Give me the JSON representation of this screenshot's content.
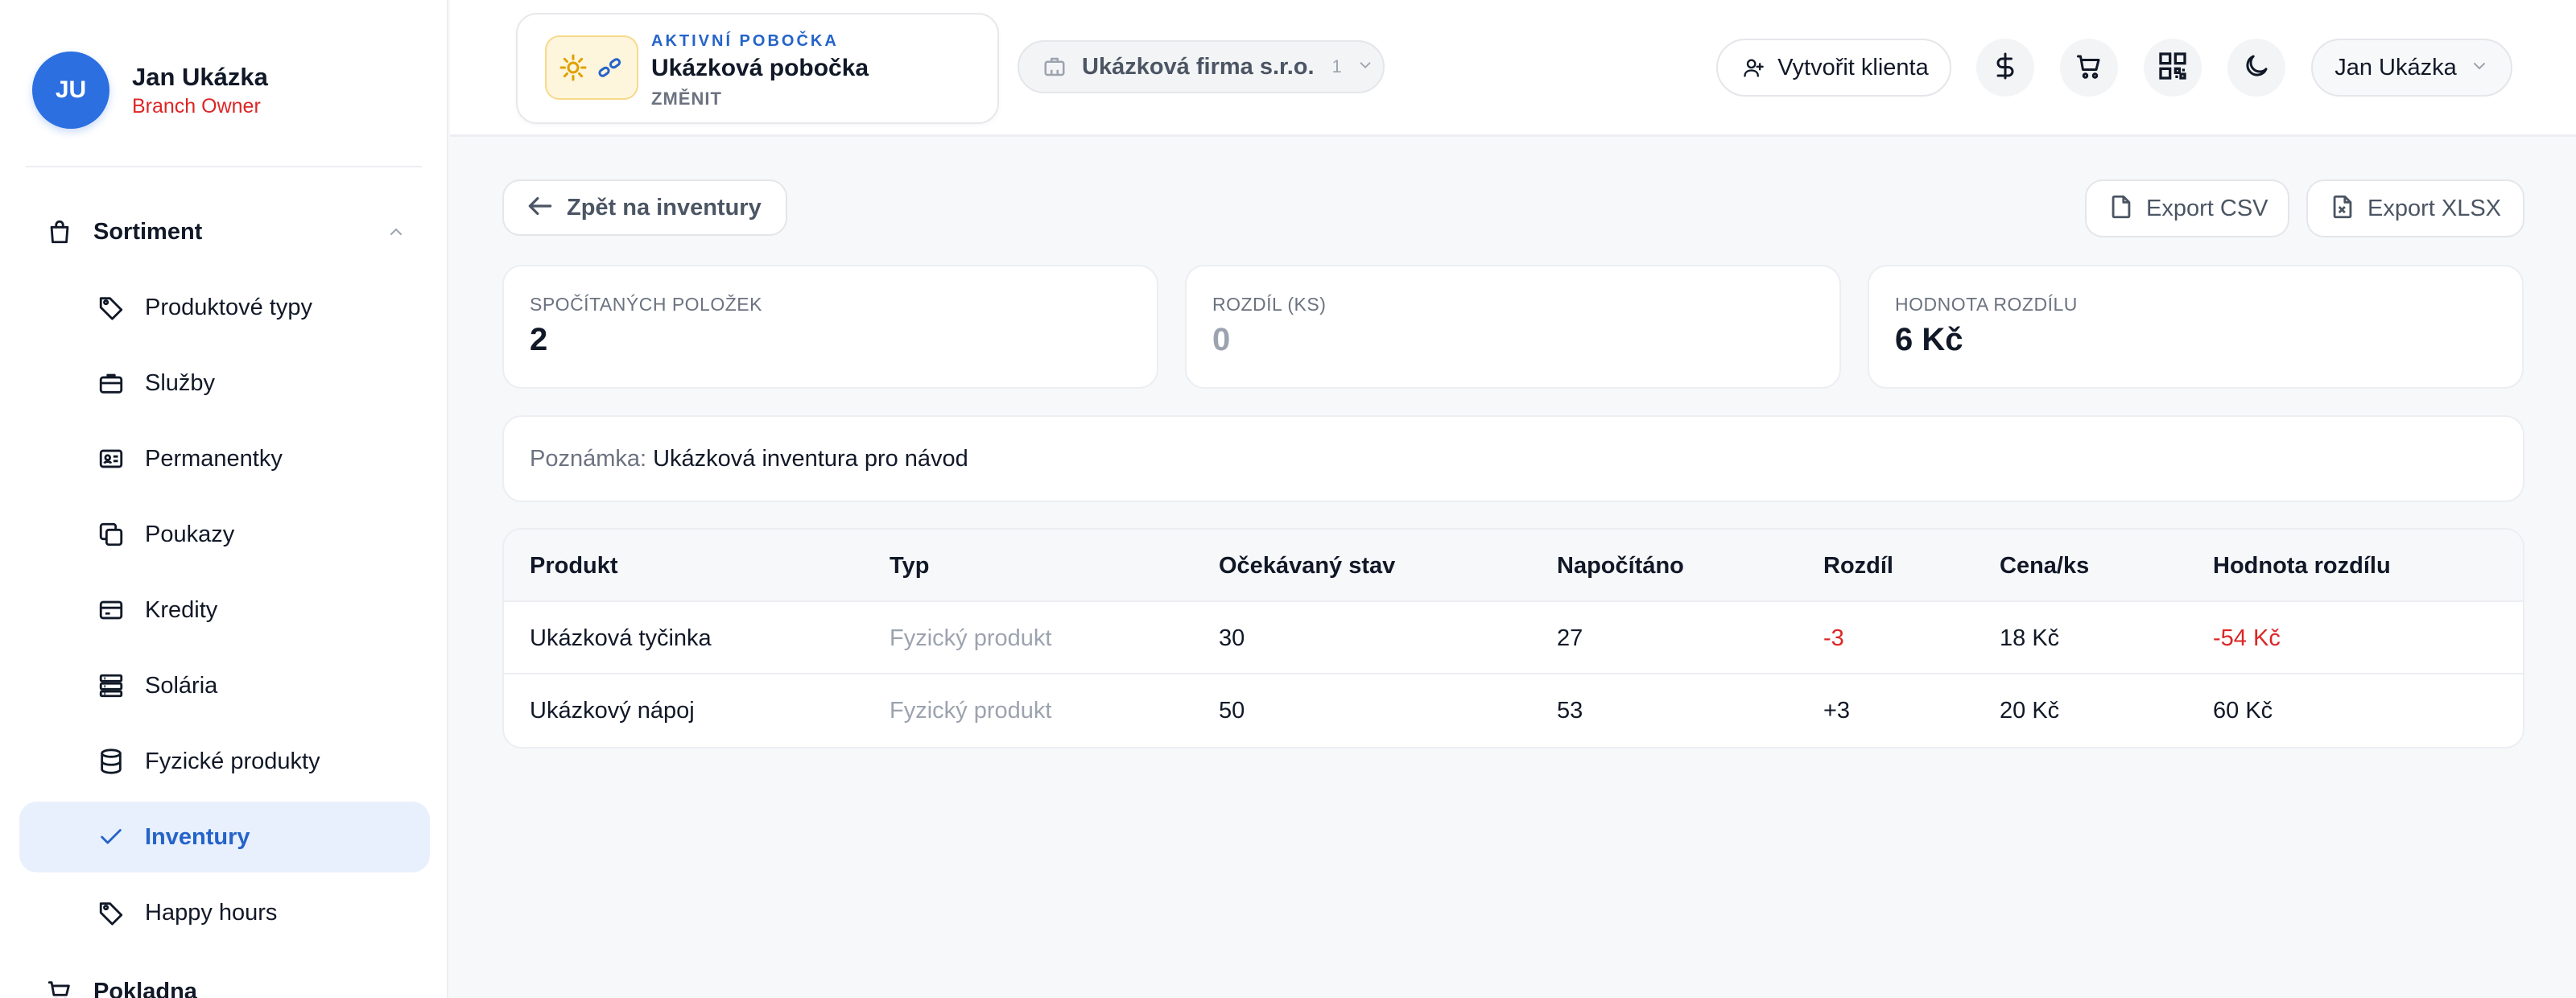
{
  "user": {
    "initials": "JU",
    "name": "Jan Ukázka",
    "role": "Branch Owner"
  },
  "sidebar": {
    "section": {
      "label": "Sortiment",
      "icon": "shopping-bag-icon"
    },
    "items": [
      {
        "label": "Produktové typy",
        "icon": "tag-icon"
      },
      {
        "label": "Služby",
        "icon": "briefcase-icon"
      },
      {
        "label": "Permanentky",
        "icon": "id-card-icon"
      },
      {
        "label": "Poukazy",
        "icon": "copy-icon"
      },
      {
        "label": "Kredity",
        "icon": "credit-card-icon"
      },
      {
        "label": "Solária",
        "icon": "server-icon"
      },
      {
        "label": "Fyzické produkty",
        "icon": "database-icon"
      },
      {
        "label": "Inventury",
        "icon": "check-icon",
        "active": true
      },
      {
        "label": "Happy hours",
        "icon": "tag-icon"
      }
    ],
    "next_section": {
      "label": "Pokladna",
      "icon": "cart-icon"
    }
  },
  "header": {
    "branch": {
      "kicker": "AKTIVNÍ POBOČKA",
      "name": "Ukázková pobočka",
      "change": "ZMĚNIT"
    },
    "company": {
      "name": "Ukázková firma s.r.o.",
      "count": "1"
    },
    "create_client": "Vytvořit klienta",
    "user_menu": "Jan Ukázka"
  },
  "actions": {
    "back": "Zpět na inventury",
    "export_csv": "Export CSV",
    "export_xlsx": "Export XLSX"
  },
  "stats": [
    {
      "label": "SPOČÍTANÝCH POLOŽEK",
      "value": "2"
    },
    {
      "label": "ROZDÍL (KS)",
      "value": "0"
    },
    {
      "label": "HODNOTA ROZDÍLU",
      "value": "6 Kč"
    }
  ],
  "note": {
    "label": "Poznámka:",
    "text": "Ukázková inventura pro návod"
  },
  "table": {
    "columns": [
      "Produkt",
      "Typ",
      "Očekávaný stav",
      "Napočítáno",
      "Rozdíl",
      "Cena/ks",
      "Hodnota rozdílu"
    ],
    "rows": [
      [
        "Ukázková tyčinka",
        "Fyzický produkt",
        "30",
        "27",
        "-3",
        "18 Kč",
        "-54 Kč"
      ],
      [
        "Ukázkový nápoj",
        "Fyzický produkt",
        "50",
        "53",
        "+3",
        "20 Kč",
        "60 Kč"
      ]
    ]
  },
  "colors": {
    "accent": "#2563c9",
    "negative": "#dc2626",
    "avatar": "#2b6fe0"
  }
}
